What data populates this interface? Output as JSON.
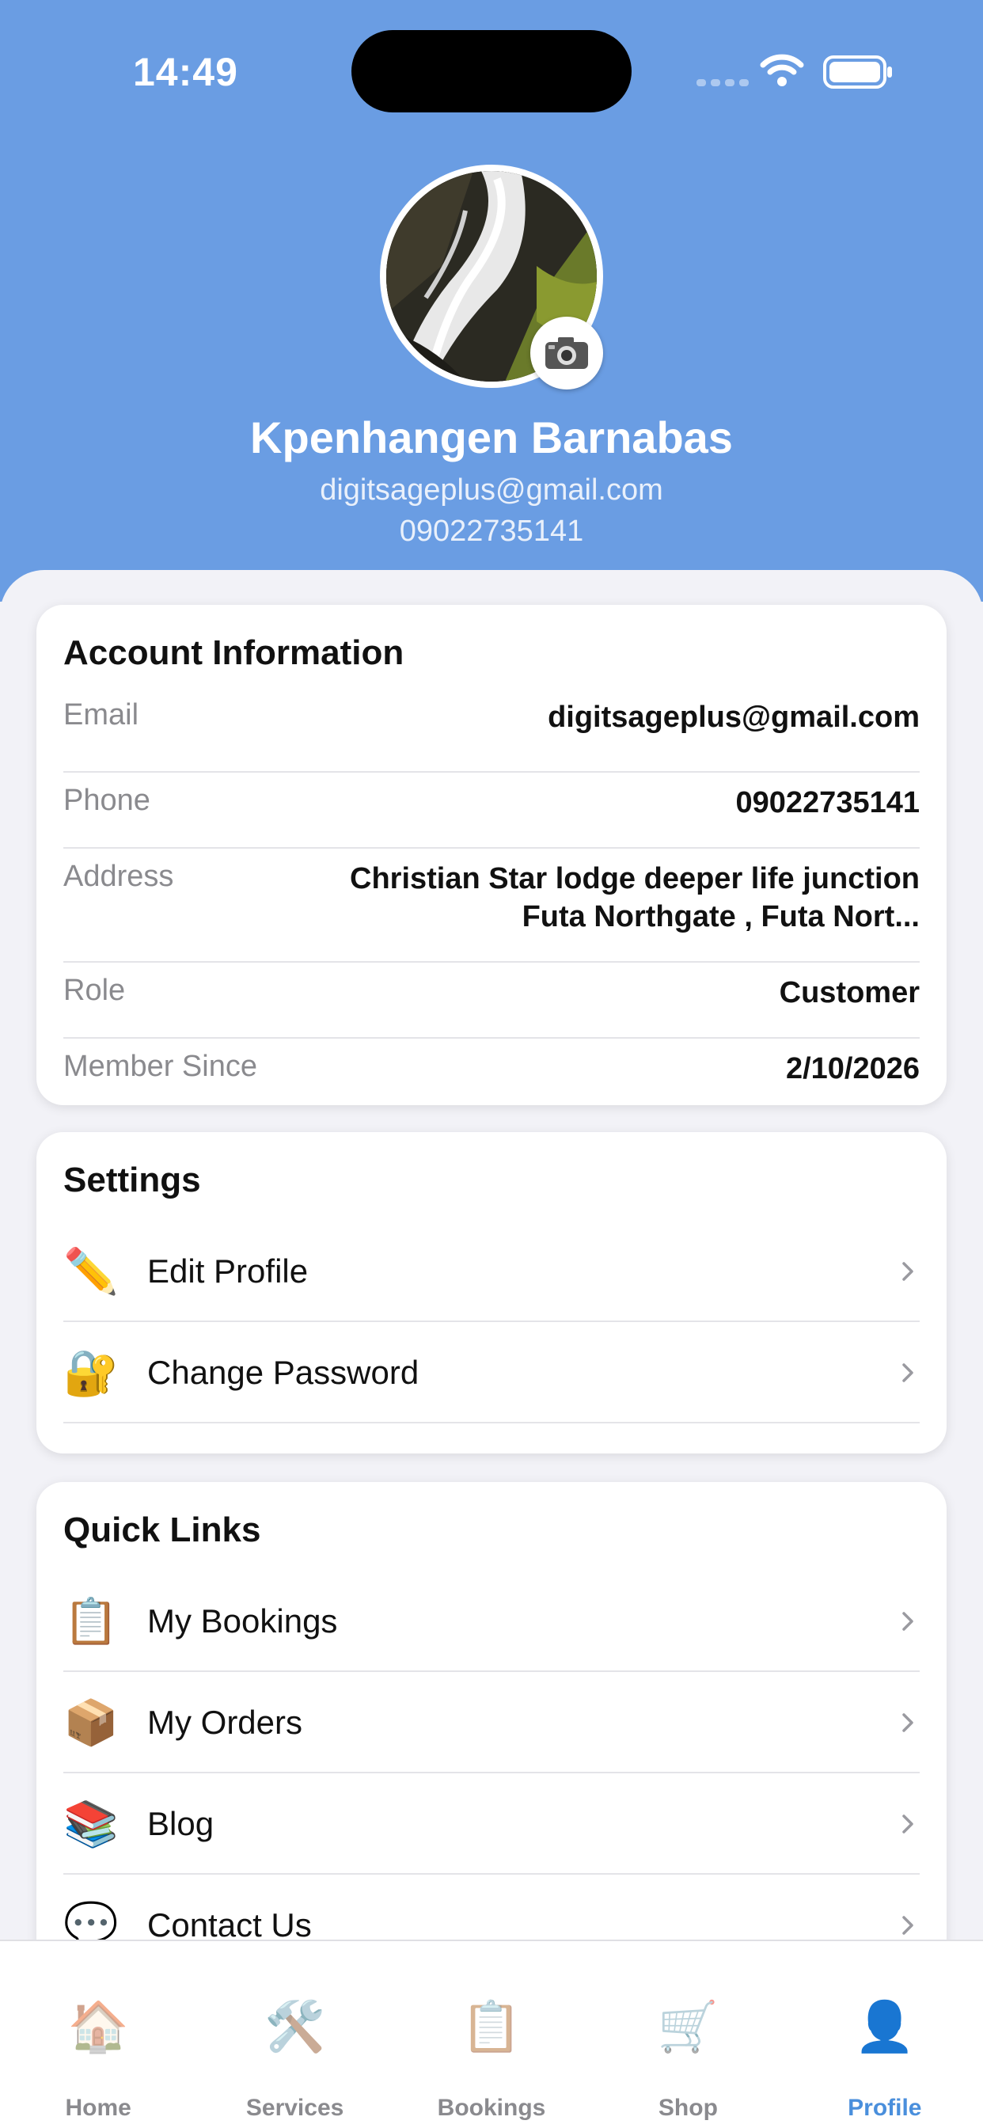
{
  "status_bar": {
    "time": "14:49"
  },
  "profile": {
    "name": "Kpenhangen Barnabas",
    "email": "digitsageplus@gmail.com",
    "phone": "09022735141"
  },
  "account_info": {
    "title": "Account Information",
    "rows": [
      {
        "label": "Email",
        "value": "digitsageplus@gmail.com"
      },
      {
        "label": "Phone",
        "value": "09022735141"
      },
      {
        "label": "Address",
        "value": "Christian Star lodge deeper life junction Futa Northgate , Futa Nort..."
      },
      {
        "label": "Role",
        "value": "Customer"
      },
      {
        "label": "Member Since",
        "value": "2/10/2026"
      }
    ]
  },
  "settings": {
    "title": "Settings",
    "items": [
      {
        "label": "Edit Profile",
        "icon": "pencil-icon"
      },
      {
        "label": "Change Password",
        "icon": "lock-key-icon"
      }
    ]
  },
  "quick_links": {
    "title": "Quick Links",
    "items": [
      {
        "label": "My Bookings",
        "icon": "clipboard-icon"
      },
      {
        "label": "My Orders",
        "icon": "package-icon"
      },
      {
        "label": "Blog",
        "icon": "books-icon"
      },
      {
        "label": "Contact Us",
        "icon": "speech-bubble-icon"
      }
    ]
  },
  "tab_bar": {
    "active": "Profile",
    "tabs": [
      {
        "label": "Home",
        "icon": "house-icon"
      },
      {
        "label": "Services",
        "icon": "tools-icon"
      },
      {
        "label": "Bookings",
        "icon": "clipboard-icon"
      },
      {
        "label": "Shop",
        "icon": "cart-icon"
      },
      {
        "label": "Profile",
        "icon": "person-icon"
      }
    ]
  },
  "colors": {
    "header_bg": "#6a9de3",
    "active_tab": "#4a8fdc"
  }
}
